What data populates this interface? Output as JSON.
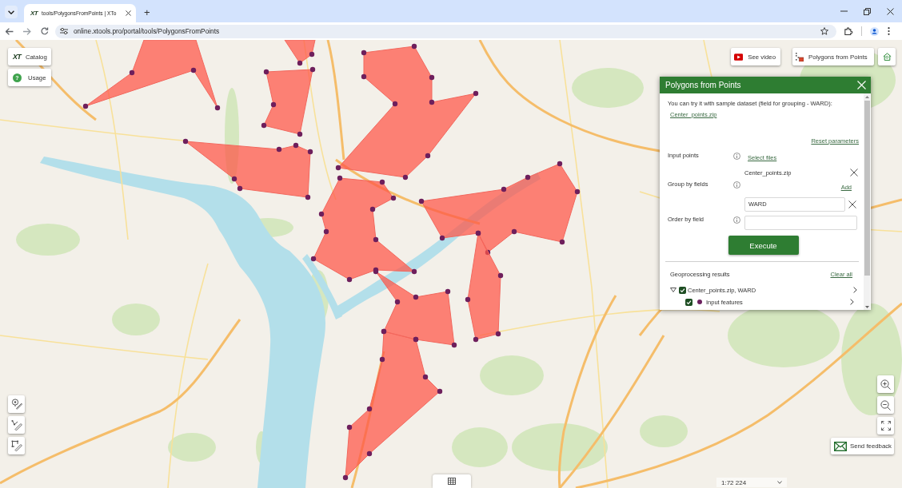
{
  "browser": {
    "tabs": [
      {
        "favicon": "XT",
        "title": "tools/PolygonsFromPoints | XTo",
        "selected": true
      }
    ],
    "new_tab": "+",
    "url": "online.xtools.pro/portal/tools/PolygonsFromPoints"
  },
  "left_buttons": [
    {
      "kind": "catalog",
      "logo": "XT",
      "label": "Catalog"
    },
    {
      "kind": "usage",
      "icon": "?",
      "label": "Usage"
    }
  ],
  "top_buttons": [
    {
      "kind": "video",
      "label": "See video"
    },
    {
      "kind": "tool",
      "label": "Polygons from Points"
    }
  ],
  "panel": {
    "title": "Polygons from Points",
    "intro": "You can try it with sample dataset (field for grouping - WARD):",
    "sample_link": "Center_points.zip",
    "reset_link": "Reset parameters",
    "input_points": {
      "label": "Input points",
      "link": "Select files",
      "file": "Center_points.zip"
    },
    "group_by": {
      "label": "Group by fields",
      "link": "Add",
      "values": [
        "WARD"
      ]
    },
    "order_by": {
      "label": "Order by field"
    },
    "execute_button": "Execute",
    "results": {
      "title": "Geoprocessing results",
      "clear_link": "Clear all",
      "items": [
        {
          "label": "Center_points.zip, WARD",
          "checked": true,
          "expanded": true,
          "children": [
            {
              "label": "Input features",
              "checked": true,
              "color": "#6b1f5e"
            }
          ]
        }
      ]
    }
  },
  "map": {
    "scale": "1:72 224"
  },
  "feedback_button": "Send feedback"
}
